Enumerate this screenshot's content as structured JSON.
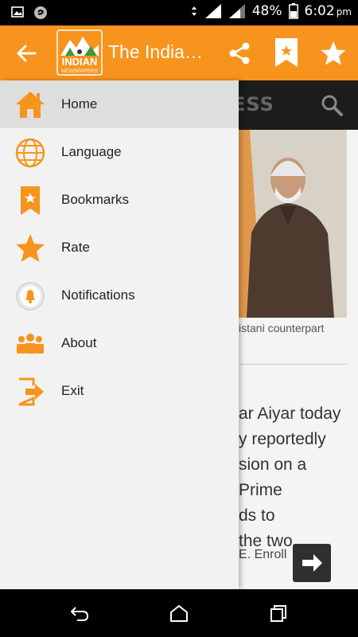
{
  "status_bar": {
    "battery": "48%",
    "time": "6:02",
    "ampm": "pm"
  },
  "toolbar": {
    "title": "The India…",
    "logo_line1": "INDIAN",
    "logo_line2": "NEWSPAPERS",
    "accent": "#F7941D"
  },
  "drawer": {
    "items": [
      {
        "label": "Home",
        "icon": "home-icon",
        "active": true
      },
      {
        "label": "Language",
        "icon": "globe-icon"
      },
      {
        "label": "Bookmarks",
        "icon": "bookmark-icon"
      },
      {
        "label": "Rate",
        "icon": "star-icon"
      },
      {
        "label": "Notifications",
        "icon": "bell-icon"
      },
      {
        "label": "About",
        "icon": "people-icon"
      },
      {
        "label": "Exit",
        "icon": "exit-icon"
      }
    ]
  },
  "background_page": {
    "header_fragment": "ESS",
    "caption": "istani counterpart",
    "article_lines": [
      "ar Aiyar today",
      "y reportedly",
      "sion on a",
      "Prime",
      "ds to",
      "the two"
    ],
    "enroll": "E. Enroll"
  }
}
